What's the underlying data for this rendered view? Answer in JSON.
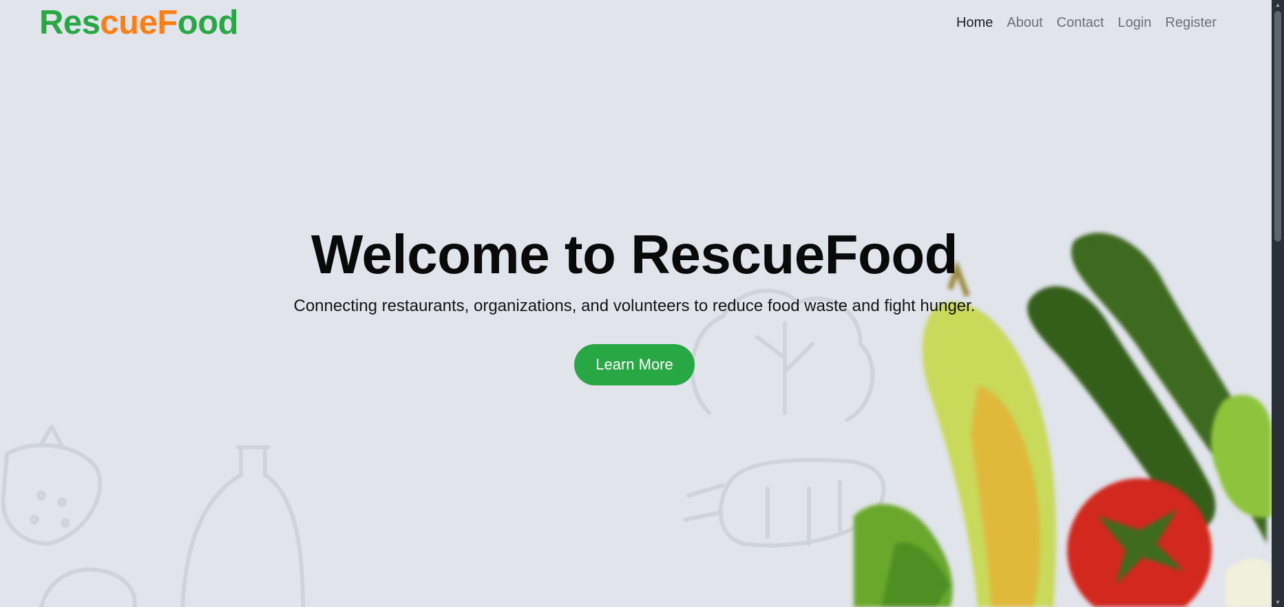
{
  "logo": {
    "part1": "Res",
    "part2": "cue",
    "part3": "F",
    "part4": "oo",
    "part5": "d"
  },
  "nav": {
    "home": "Home",
    "about": "About",
    "contact": "Contact",
    "login": "Login",
    "register": "Register"
  },
  "hero": {
    "title": "Welcome to RescueFood",
    "subtitle": "Connecting restaurants, organizations, and volunteers to reduce food waste and fight hunger.",
    "cta": "Learn More"
  },
  "colors": {
    "brand_green": "#28a745",
    "brand_orange": "#fd7e14",
    "background": "#e1e4eb"
  }
}
